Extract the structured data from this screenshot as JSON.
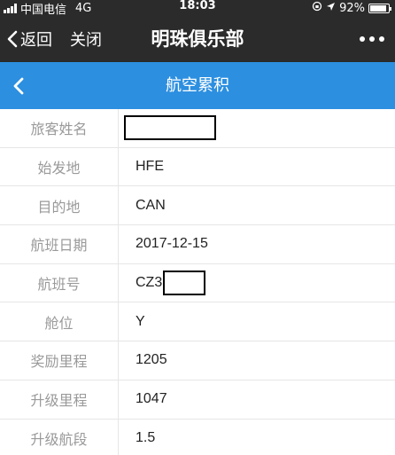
{
  "status_bar": {
    "carrier": "中国电信",
    "network": "4G",
    "time": "18:03",
    "battery": "92%",
    "battery_level": 0.92
  },
  "wechat_bar": {
    "back_label": "返回",
    "close_label": "关闭",
    "title": "明珠俱乐部",
    "more_icon": "more-dots-icon"
  },
  "app_header": {
    "title": "航空累积",
    "back_icon": "chevron-left-icon",
    "color": "#2c8fe0"
  },
  "details": [
    {
      "label": "旅客姓名",
      "value": "",
      "redacted": true
    },
    {
      "label": "始发地",
      "value": "HFE"
    },
    {
      "label": "目的地",
      "value": "CAN"
    },
    {
      "label": "航班日期",
      "value": "2017-12-15"
    },
    {
      "label": "航班号",
      "value": "CZ3",
      "redacted": true
    },
    {
      "label": "舱位",
      "value": "Y"
    },
    {
      "label": "奖励里程",
      "value": "1205"
    },
    {
      "label": "升级里程",
      "value": "1047"
    },
    {
      "label": "升级航段",
      "value": "1.5"
    }
  ]
}
